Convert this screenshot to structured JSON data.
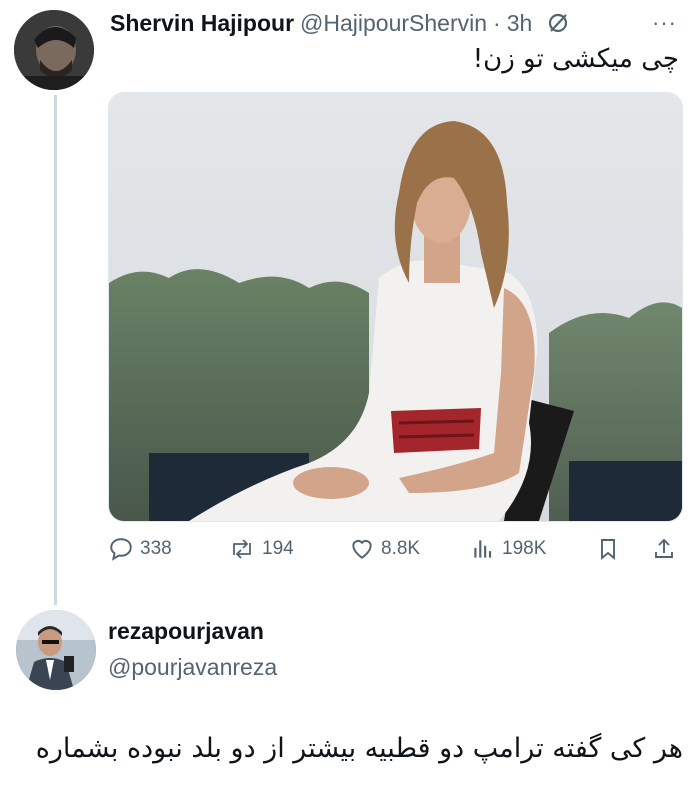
{
  "tweet": {
    "author_name": "Shervin Hajipour",
    "handle": "@HajipourShervin",
    "separator": "·",
    "time": "3h",
    "more_label": "···",
    "text": "چی میکشی تو زن!",
    "image_icon": "photo-of-woman-in-white-dress",
    "stats": {
      "replies": "338",
      "reposts": "194",
      "likes": "8.8K",
      "views": "198K"
    }
  },
  "reply": {
    "author_name": "rezapourjavan",
    "handle": "@pourjavanreza",
    "text": "هر کی گفته ترامپ دو قطبیه بیشتر از دو بلد نبوده بشماره"
  },
  "colors": {
    "text_primary": "#0f1419",
    "text_secondary": "#536471",
    "thread_line": "#cfd9de"
  }
}
